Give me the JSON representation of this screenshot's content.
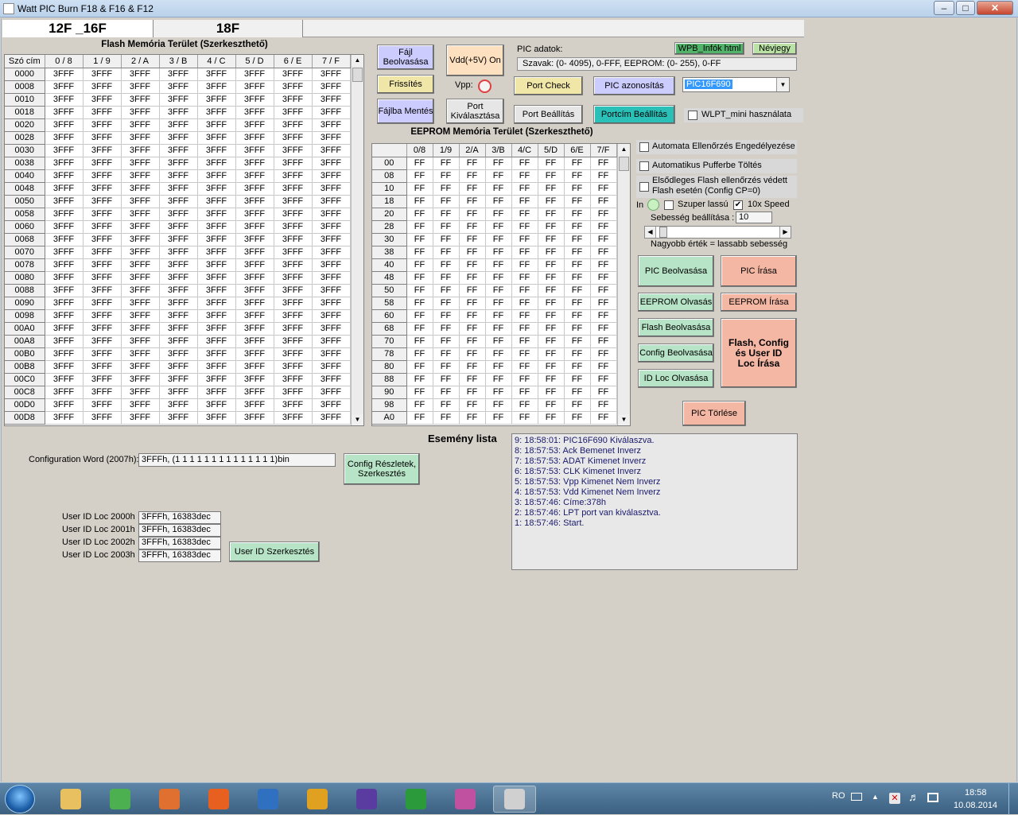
{
  "window": {
    "title": "Watt PIC Burn F18 & F16 & F12"
  },
  "tabs": [
    "12F _16F",
    "18F"
  ],
  "flash": {
    "title": "Flash Memória Terület (Szerkeszthető)",
    "headers": [
      "Szó cím",
      "0 / 8",
      "1 / 9",
      "2 / A",
      "3 / B",
      "4 / C",
      "5 / D",
      "6 / E",
      "7 / F"
    ],
    "addresses": [
      "0000",
      "0008",
      "0010",
      "0018",
      "0020",
      "0028",
      "0030",
      "0038",
      "0040",
      "0048",
      "0050",
      "0058",
      "0060",
      "0068",
      "0070",
      "0078",
      "0080",
      "0088",
      "0090",
      "0098",
      "00A0",
      "00A8",
      "00B0",
      "00B8",
      "00C0",
      "00C8",
      "00D0",
      "00D8"
    ],
    "cell": "3FFF"
  },
  "eeprom": {
    "title": "EEPROM Memória Terület (Szerkeszthető)",
    "headers": [
      "",
      "0/8",
      "1/9",
      "2/A",
      "3/B",
      "4/C",
      "5/D",
      "6/E",
      "7/F"
    ],
    "addresses": [
      "00",
      "08",
      "10",
      "18",
      "20",
      "28",
      "30",
      "38",
      "40",
      "48",
      "50",
      "58",
      "60",
      "68",
      "70",
      "78",
      "80",
      "88",
      "90",
      "98",
      "A0"
    ],
    "cell": "FF"
  },
  "buttons": {
    "fajl_beolvasasa": "Fájl Beolvasása",
    "vdd_on": "Vdd(+5V) On",
    "frissites": "Frissítés",
    "vpp": "Vpp:",
    "fajlba_mentes": "Fájlba Mentés",
    "port_kivalasztasa": "Port Kiválasztása",
    "port_check": "Port Check",
    "pic_azonositas": "PIC azonosítás",
    "port_beallitas": "Port Beállítás",
    "portcim_beallitas": "Portcím Beállítás",
    "wpb_infok": "WPB_Infók html",
    "nevjegy": "Névjegy",
    "pic_beolvasasa": "PIC Beolvasása",
    "pic_irasa": "PIC   Írása",
    "eeprom_olvasas": "EEPROM Olvasás",
    "eeprom_irasa": "EEPROM Írása",
    "flash_beolvasasa": "Flash Beolvasása",
    "config_beolvasasa": "Config Beolvasása",
    "id_loc_olvasasa": "ID Loc Olvasása",
    "flash_config_irasa": "Flash, Config és User ID Loc Írása",
    "pic_torlese": "PIC  Törlése",
    "config_reszletek": "Config Részletek, Szerkesztés",
    "user_id_szerkesztes": "User ID Szerkesztés"
  },
  "pic_info": {
    "label": "PIC adatok:",
    "value": "Szavak: (0- 4095),  0-FFF,   EEPROM: (0- 255),  0-FF",
    "selected_device": "PIC16F690"
  },
  "options": {
    "wlpt_mini": "WLPT_mini használata",
    "auto_check": "Automata Ellenőrzés Engedélyezése",
    "auto_buffer": "Automatikus Pufferbe Töltés",
    "primary_flash_check": "Elsődleges Flash ellenőrzés védett Flash esetén (Config CP=0)",
    "in_label": "In",
    "super_slow": "Szuper lassú",
    "speed10x": "10x Speed",
    "speed10x_checked": true,
    "speed_label": "Sebesség beállítása :",
    "speed_value": "10",
    "speed_hint": "Nagyobb érték = lassabb sebesség",
    "speed_level": 0.02
  },
  "config": {
    "label": "Configuration Word (2007h):",
    "value": "3FFFh, (1 1 1 1 1 1 1 1 1 1 1 1 1 1)bin"
  },
  "user_ids": [
    {
      "label": "User ID Loc 2000h",
      "value": "3FFFh, 16383dec"
    },
    {
      "label": "User ID Loc 2001h",
      "value": "3FFFh, 16383dec"
    },
    {
      "label": "User ID Loc 2002h",
      "value": "3FFFh, 16383dec"
    },
    {
      "label": "User ID Loc 2003h",
      "value": "3FFFh, 16383dec"
    }
  ],
  "events": {
    "title": "Esemény lista",
    "lines": [
      "9:  18:58:01:  PIC16F690 Kiválaszva.",
      "8:  18:57:53:  Ack Bemenet Inverz",
      "7:  18:57:53:  ADAT Kimenet Inverz",
      "6:  18:57:53:  CLK Kimenet Inverz",
      "5:  18:57:53:  Vpp Kimenet Nem Inverz",
      "4:  18:57:53:  Vdd Kimenet Nem Inverz",
      "3:  18:57:46:  Címe:378h",
      "2:  18:57:46:  LPT port van kiválasztva.",
      "1:  18:57:46:  Start."
    ]
  },
  "taskbar": {
    "lang": "RO",
    "time": "18:58",
    "date": "10.08.2014",
    "apps": [
      "windows-explorer",
      "chrome",
      "media-player",
      "firefox",
      "save-app",
      "winamp",
      "visual-studio",
      "utorrent",
      "messenger",
      "picburn-active"
    ]
  },
  "colors": {
    "lavender": "#ccccff",
    "green": "#b7e4c7",
    "salmon": "#f4b7a4",
    "yellow": "#f0e6a8",
    "peach": "#fde0c0",
    "teal": "#2ac0b8",
    "wpb_green": "#52b46a",
    "nevjegy": "#b9e2a4",
    "lightgray": "#e6e6e6"
  }
}
